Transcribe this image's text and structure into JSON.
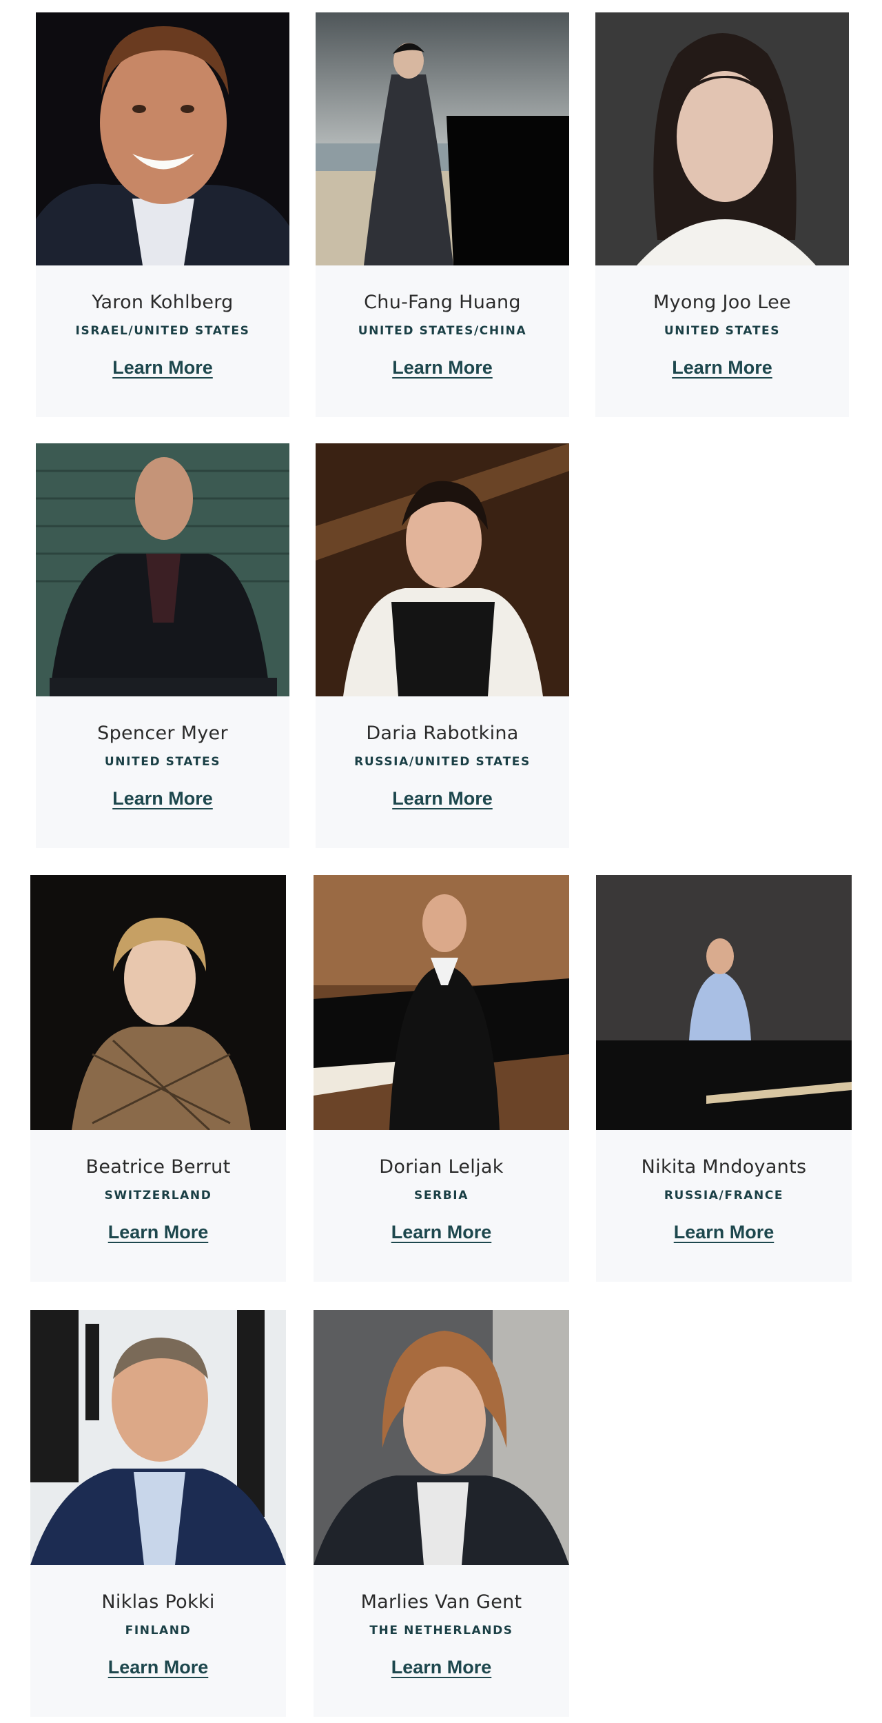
{
  "artists": [
    {
      "name": "Yaron Kohlberg",
      "country": "ISRAEL/UNITED STATES",
      "link": "Learn More",
      "portrait": "portrait-smiling-man-curly-hair"
    },
    {
      "name": "Chu-Fang Huang",
      "country": "UNITED STATES/CHINA",
      "link": "Learn More",
      "portrait": "woman-at-piano-by-sea"
    },
    {
      "name": "Myong Joo Lee",
      "country": "UNITED STATES",
      "link": "Learn More",
      "portrait": "portrait-woman-dark-hair"
    },
    {
      "name": "Spencer Myer",
      "country": "UNITED STATES",
      "link": "Learn More",
      "portrait": "man-in-dark-suit-brick-wall"
    },
    {
      "name": "Daria Rabotkina",
      "country": "RUSSIA/UNITED STATES",
      "link": "Learn More",
      "portrait": "woman-in-black-vest-by-piano"
    },
    {
      "name": "Beatrice Berrut",
      "country": "SWITZERLAND",
      "link": "Learn More",
      "portrait": "woman-blonde-sequin-dress"
    },
    {
      "name": "Dorian Leljak",
      "country": "SERBIA",
      "link": "Learn More",
      "portrait": "man-in-tuxedo-beside-grand-piano"
    },
    {
      "name": "Nikita Mndoyants",
      "country": "RUSSIA/FRANCE",
      "link": "Learn More",
      "portrait": "man-leaning-on-piano-grey-backdrop"
    },
    {
      "name": "Niklas Pokki",
      "country": "FINLAND",
      "link": "Learn More",
      "portrait": "smiling-man-navy-blazer"
    },
    {
      "name": "Marlies Van Gent",
      "country": "THE NETHERLANDS",
      "link": "Learn More",
      "portrait": "woman-auburn-hair-dark-jacket"
    }
  ],
  "colors": {
    "card_bg": "#f7f8fa",
    "name_text": "#2b2b2b",
    "country_text": "#1a3f45",
    "link_text": "#1d474d"
  }
}
